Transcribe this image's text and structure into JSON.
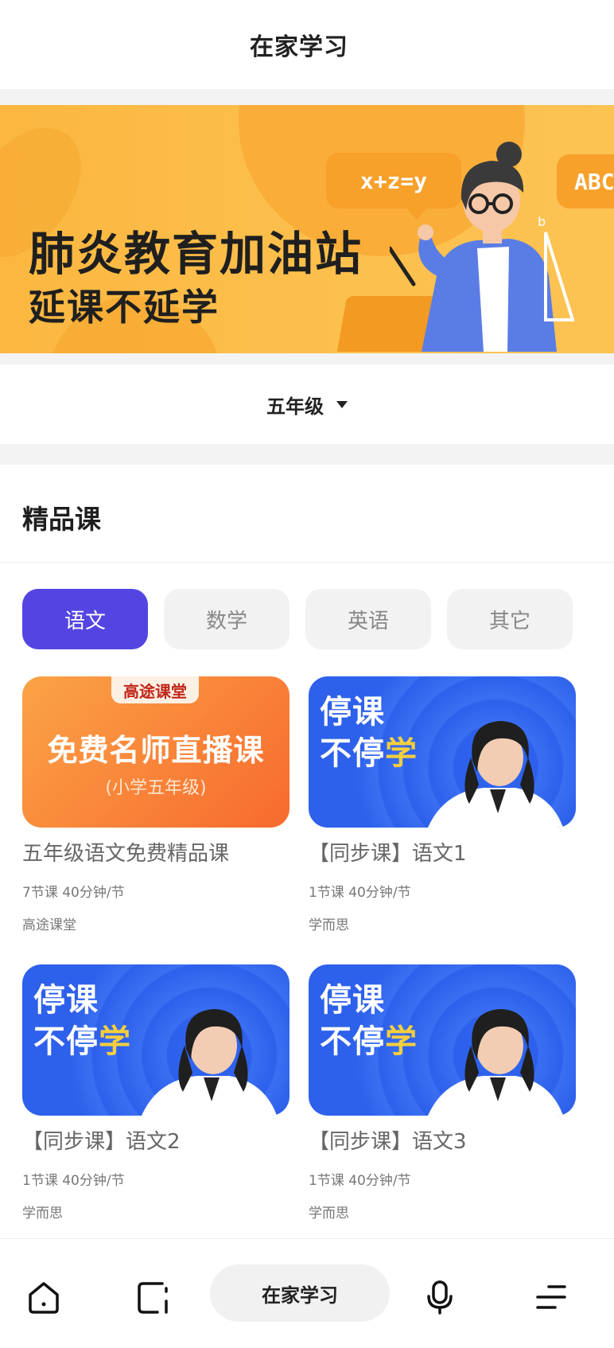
{
  "header": {
    "title": "在家学习"
  },
  "banner": {
    "headline": "肺炎教育加油站",
    "subline": "延课不延学",
    "bubble_left": "x+z=y",
    "bubble_right": "ABC",
    "colors": {
      "background": "#fcbf4c",
      "bubble": "#f7a02a"
    }
  },
  "grade_selector": {
    "label": "五年级",
    "icon": "caret-down-icon"
  },
  "section": {
    "title": "精品课"
  },
  "tabs": [
    {
      "label": "语文",
      "active": true
    },
    {
      "label": "数学",
      "active": false
    },
    {
      "label": "英语",
      "active": false
    },
    {
      "label": "其它",
      "active": false
    }
  ],
  "courses": [
    {
      "thumb_badge": "高途课堂",
      "thumb_title": "免费名师直播课",
      "thumb_subtitle": "(小学五年级)",
      "name": "五年级语文免费精品课",
      "meta": "7节课 40分钟/节",
      "source": "高途课堂"
    },
    {
      "thumb_line1": "停课",
      "thumb_line2a": "不停",
      "thumb_line2b": "学",
      "name": "【同步课】语文1",
      "meta": "1节课 40分钟/节",
      "source": "学而思"
    },
    {
      "thumb_line1": "停课",
      "thumb_line2a": "不停",
      "thumb_line2b": "学",
      "name": "【同步课】语文2",
      "meta": "1节课 40分钟/节",
      "source": "学而思"
    },
    {
      "thumb_line1": "停课",
      "thumb_line2a": "不停",
      "thumb_line2b": "学",
      "name": "【同步课】语文3",
      "meta": "1节课 40分钟/节",
      "source": "学而思"
    }
  ],
  "bottom_nav": {
    "items": [
      "home-icon",
      "app-window-icon",
      "microphone-icon",
      "menu-icon"
    ],
    "center_label": "在家学习"
  },
  "theme": {
    "accent": "#5445e3",
    "tab_inactive_bg": "#f2f2f2",
    "highlight_yellow": "#f7cf3c"
  }
}
